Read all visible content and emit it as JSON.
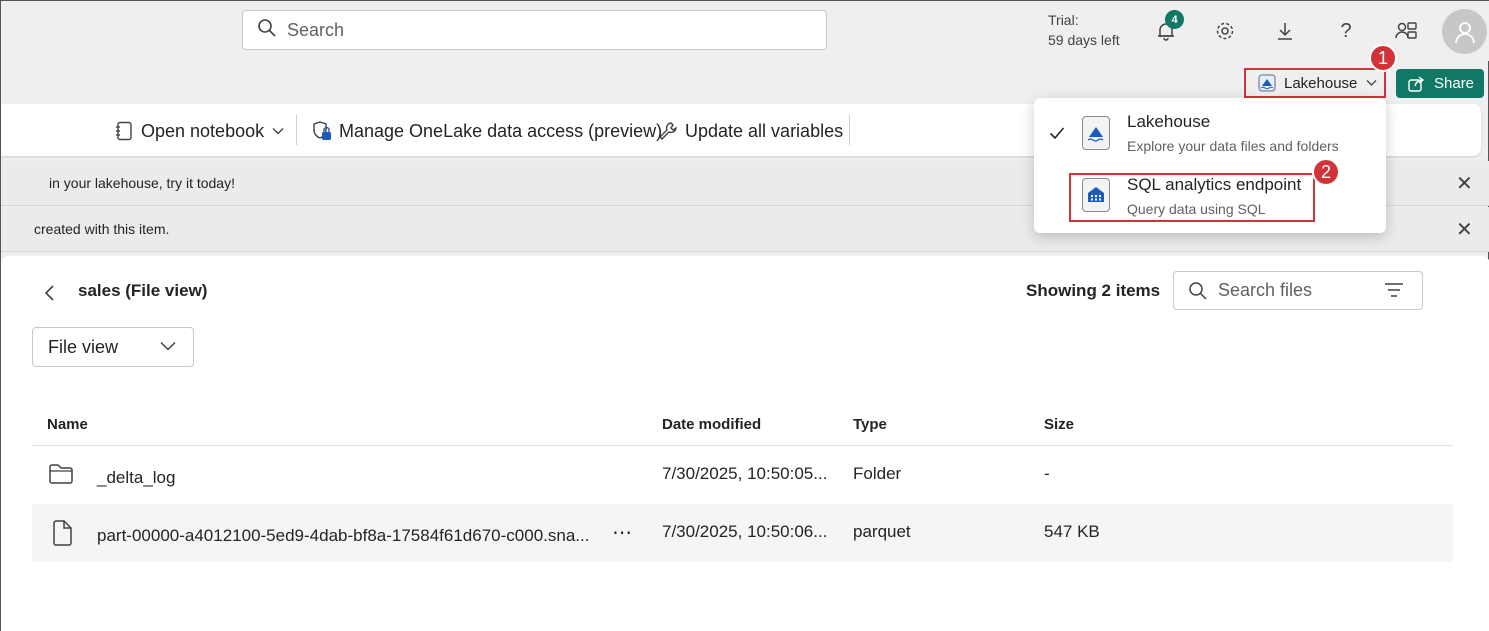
{
  "header": {
    "search_placeholder": "Search",
    "trial_line1": "Trial:",
    "trial_line2": "59 days left",
    "notification_count": "4",
    "icons": [
      "bell-icon",
      "gear-icon",
      "download-icon",
      "help-icon",
      "people-icon",
      "avatar"
    ]
  },
  "toolbar": {
    "workload_label": "Lakehouse",
    "share_label": "Share",
    "ribbon": [
      {
        "label": "Open notebook",
        "icon": "notebook-icon"
      },
      {
        "label": "Manage OneLake data access (preview)",
        "icon": "shield-lock-icon"
      },
      {
        "label": "Update all variables",
        "icon": "wrench-icon"
      }
    ]
  },
  "banners": [
    {
      "text": "in your lakehouse, try it today!"
    },
    {
      "text": "created with this item."
    }
  ],
  "dropdown": {
    "items": [
      {
        "title": "Lakehouse",
        "subtitle": "Explore your data files and folders",
        "checked": true
      },
      {
        "title": "SQL analytics endpoint",
        "subtitle": "Query data using SQL",
        "checked": false
      }
    ]
  },
  "callouts": {
    "step1": "1",
    "step2": "2"
  },
  "files": {
    "title": "sales (File view)",
    "showing": "Showing 2 items",
    "search_placeholder": "Search files",
    "view_select": "File view",
    "columns": {
      "name": "Name",
      "date": "Date modified",
      "type": "Type",
      "size": "Size"
    },
    "rows": [
      {
        "name": "_delta_log",
        "date": "7/30/2025, 10:50:05...",
        "type": "Folder",
        "size": "-",
        "icon": "folder-icon"
      },
      {
        "name": "part-00000-a4012100-5ed9-4dab-bf8a-17584f61d670-c000.sna...",
        "date": "7/30/2025, 10:50:06...",
        "type": "parquet",
        "size": "547 KB",
        "icon": "file-icon"
      }
    ]
  },
  "colors": {
    "accent": "#117865",
    "highlight": "#d13438"
  }
}
